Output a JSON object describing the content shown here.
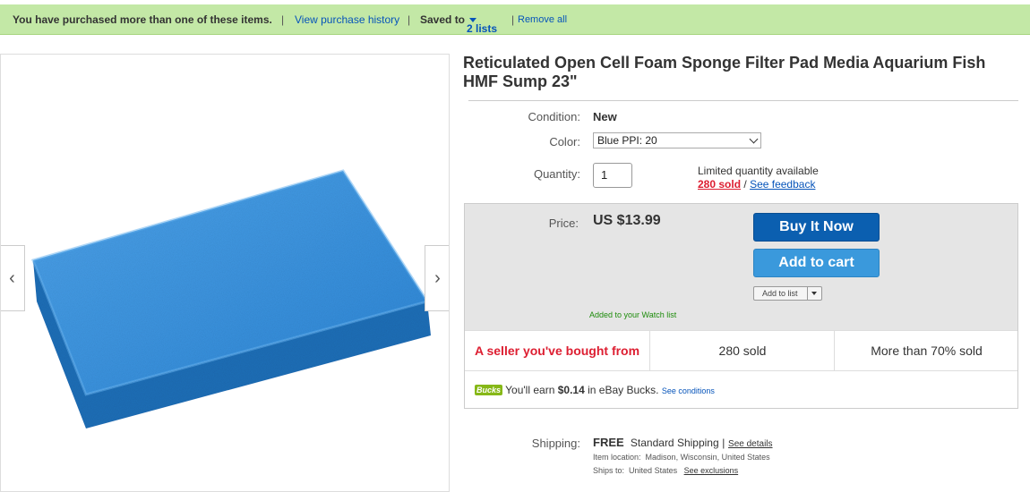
{
  "notice": {
    "message": "You have purchased more than one of these items.",
    "sep1": "|",
    "history_link": "View purchase history",
    "sep2": "|",
    "saved_prefix": "Saved to",
    "saved_link": "2 lists",
    "sep3": "|",
    "remove_link": "Remove all"
  },
  "title": "Reticulated Open Cell Foam Sponge Filter Pad Media Aquarium Fish HMF Sump 23\"",
  "condition": {
    "label": "Condition:",
    "value": "New"
  },
  "color": {
    "label": "Color:",
    "selected": "Blue PPI: 20"
  },
  "quantity": {
    "label": "Quantity:",
    "value": "1",
    "availability": "Limited quantity available",
    "sold_link": "280 sold",
    "slash": "/",
    "feedback_link": "See feedback"
  },
  "price": {
    "label": "Price:",
    "value": "US $13.99"
  },
  "buttons": {
    "buy_now": "Buy It Now",
    "add_to_cart": "Add to cart",
    "add_to_list": "Add to list"
  },
  "watch_message": "Added to your Watch list",
  "stats": {
    "seller": "A seller you've bought from",
    "sold": "280 sold",
    "percent": "More than 70% sold"
  },
  "bucks": {
    "badge": "Bucks",
    "prefix": "You'll earn",
    "amount": "$0.14",
    "suffix": "in eBay Bucks.",
    "link": "See conditions"
  },
  "shipping": {
    "label": "Shipping:",
    "cost": "FREE",
    "method": "Standard Shipping",
    "sep": "|",
    "details_link": "See details",
    "location_label": "Item location:",
    "location": "Madison, Wisconsin, United States",
    "ships_label": "Ships to:",
    "ships_to": "United States",
    "exclusions_link": "See exclusions"
  },
  "gallery": {
    "prev_glyph": "‹",
    "next_glyph": "›"
  },
  "colors": {
    "notice_bg": "#c3e8a6",
    "buy_button": "#0b5fb0",
    "cart_button": "#3a99dc",
    "sponge_blue": "#2a86d6",
    "seller_red": "#dd1e31"
  }
}
